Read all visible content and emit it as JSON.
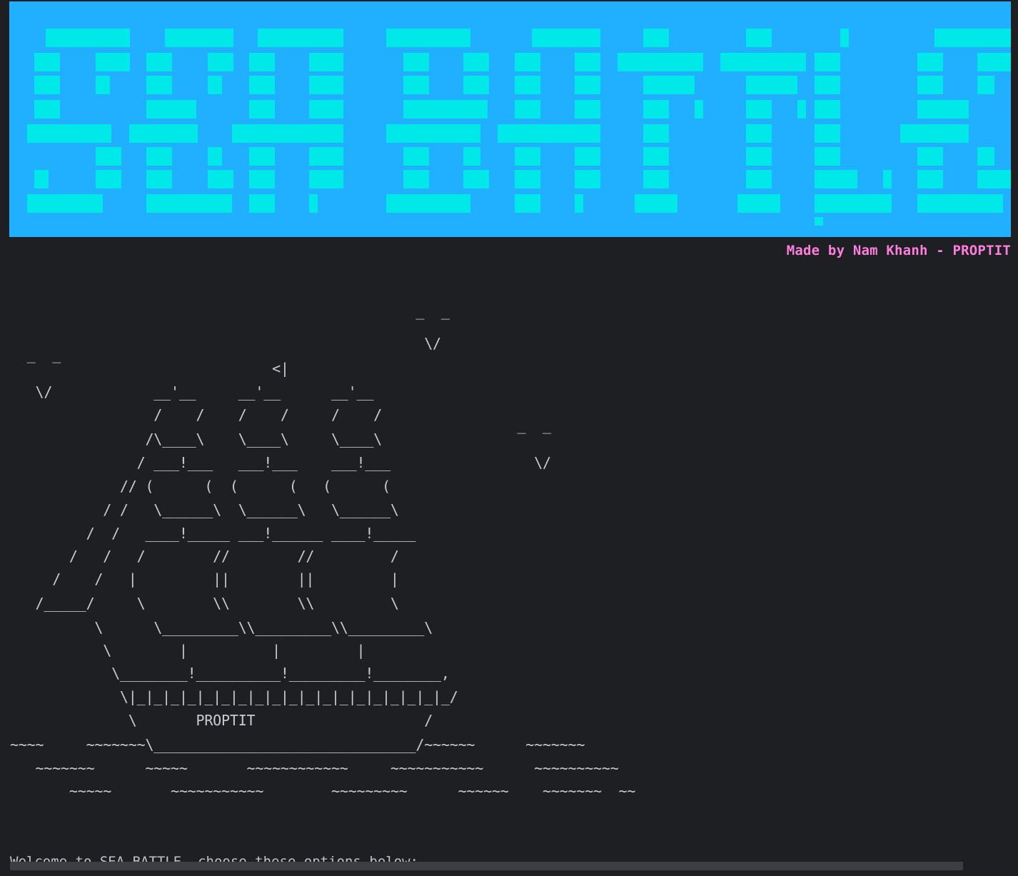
{
  "banner": {
    "title": "SEA BATTLE",
    "background_color": "#21b0ff",
    "block_color": "#00e8e8"
  },
  "credit": {
    "text": "Made by Nam Khanh - PROPTIT",
    "color": "#ff7ddc"
  },
  "ascii_art": {
    "lines": [
      "                                                ‾  ‾",
      "                                                 \\/",
      "  ‾  ‾                         <|",
      "   \\/            __'__     __'__      __'__",
      "                 /    /    /    /     /    /",
      "                /\\____\\    \\____\\     \\____\\                ‾  ‾",
      "               / ___!___   ___!___    ___!___                 \\/",
      "             // (      (  (      (   (      (",
      "           / /   \\______\\  \\______\\   \\______\\",
      "         /  /   ____!_____ ___!______ ____!_____",
      "       /   /   /        //        //         /",
      "     /    /   |         ||        ||         |",
      "   /_____/     \\        \\\\        \\\\         \\",
      "          \\      \\_________\\\\_________\\\\_________\\",
      "           \\        |          |         |",
      "            \\________!__________!_________!________,",
      "             \\|_|_|_|_|_|_|_|_|_|_|_|_|_|_|_|_|_|_|_/",
      "              \\       PROPTIT                    /",
      "~~~~     ~~~~~~~\\_______________________________/~~~~~~      ~~~~~~~",
      "   ~~~~~~~      ~~~~~       ~~~~~~~~~~~~     ~~~~~~~~~~~      ~~~~~~~~~~",
      "       ~~~~~       ~~~~~~~~~~~        ~~~~~~~~~      ~~~~~~    ~~~~~~~  ~~"
    ]
  },
  "prompt": {
    "text": "Welcome to SEA BATTLE, choose these options below:"
  }
}
